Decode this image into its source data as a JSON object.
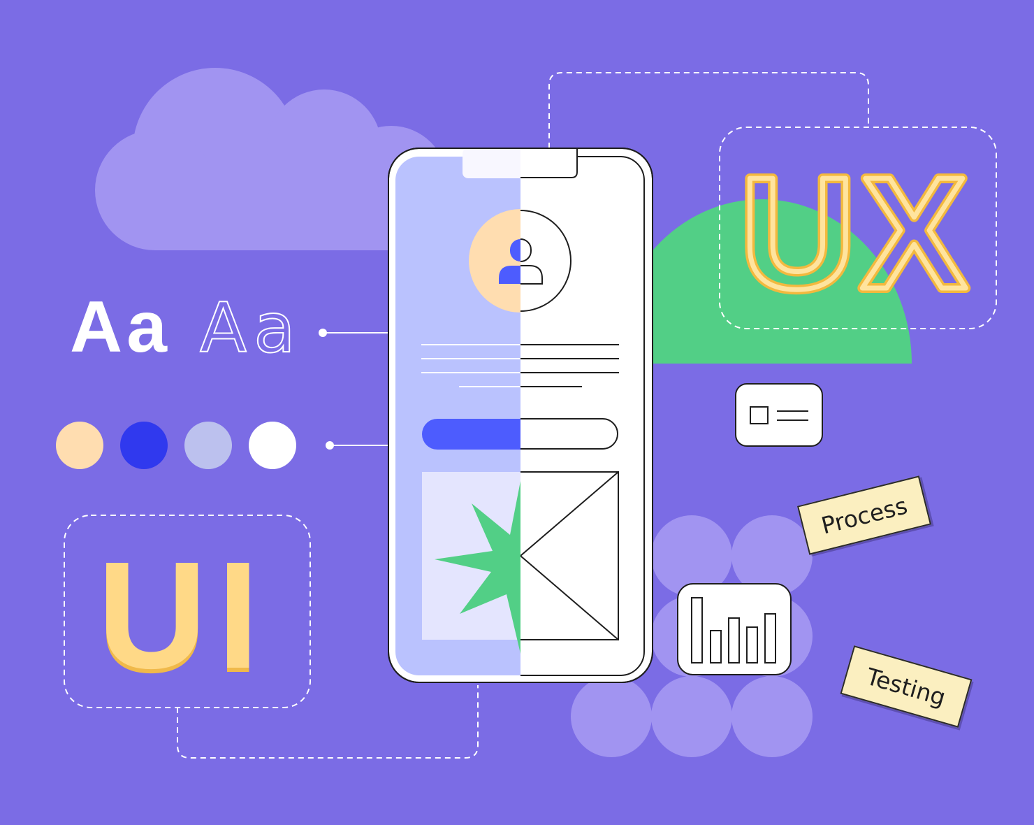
{
  "typography": {
    "bold_sample": "Aa",
    "light_sample": "Aa"
  },
  "palette": {
    "background": "#7B6CE5",
    "swatches": [
      "#FFDDB0",
      "#3039EE",
      "#BCC1EE",
      "#FFFFFF"
    ],
    "accent_green": "#52CF86",
    "accent_yellow": "#FFD987",
    "cloud": "#A194F1",
    "phone_ui_fill": "#BAC2FE",
    "button_blue": "#4D5CFE"
  },
  "labels": {
    "ui": "UI",
    "ux": "UX"
  },
  "tags": [
    "Process",
    "Testing"
  ],
  "icons": [
    "cloud-icon",
    "user-icon",
    "starburst-icon",
    "image-placeholder-icon",
    "id-card-icon",
    "bar-chart-icon"
  ]
}
